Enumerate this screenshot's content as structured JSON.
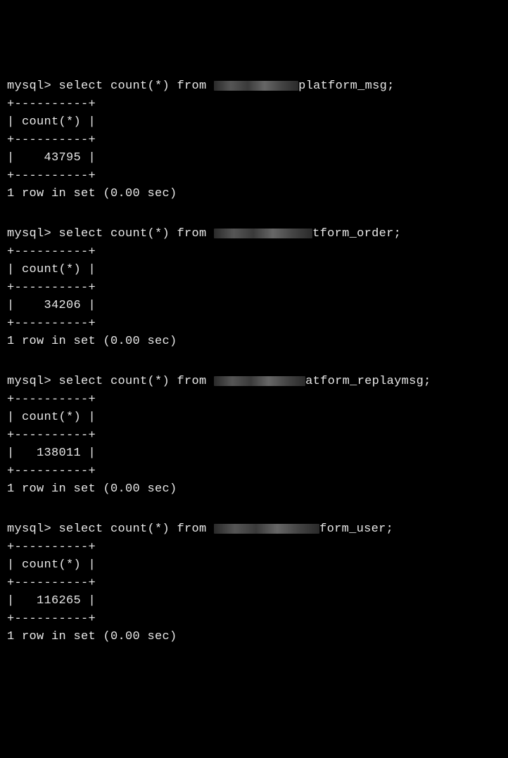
{
  "prompt": "mysql> ",
  "border_top_bottom": "+----------+",
  "header": "| count(*) |",
  "queries": [
    {
      "sql_prefix": "select count(*) from ",
      "redacted_width": 120,
      "sql_suffix_visible": "platform_msg;",
      "value": "|    43795 |",
      "footer": "1 row in set (0.00 sec)"
    },
    {
      "sql_prefix": "select count(*) from ",
      "redacted_width": 140,
      "sql_suffix_visible": "tform_order;",
      "value": "|    34206 |",
      "footer": "1 row in set (0.00 sec)"
    },
    {
      "sql_prefix": "select count(*) from ",
      "redacted_width": 130,
      "sql_suffix_visible": "atform_replaymsg;",
      "value": "|   138011 |",
      "footer": "1 row in set (0.00 sec)"
    },
    {
      "sql_prefix": "select count(*) from ",
      "redacted_width": 150,
      "sql_suffix_visible": "form_user;",
      "value": "|   116265 |",
      "footer": "1 row in set (0.00 sec)"
    }
  ]
}
